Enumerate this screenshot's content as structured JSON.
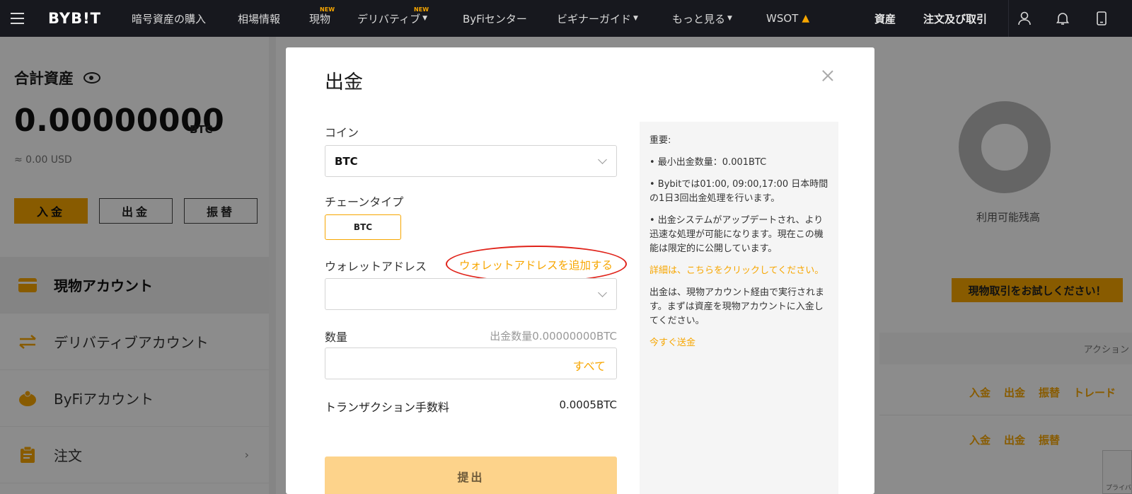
{
  "nav": {
    "logo": "BYB!T",
    "items": [
      {
        "label": "暗号資産の購入",
        "badge": ""
      },
      {
        "label": "相場情報",
        "badge": ""
      },
      {
        "label": "現物",
        "badge": "NEW"
      },
      {
        "label": "デリバティブ",
        "badge": "NEW"
      },
      {
        "label": "ByFiセンター",
        "badge": ""
      },
      {
        "label": "ビギナーガイド",
        "badge": ""
      },
      {
        "label": "もっと見る",
        "badge": ""
      },
      {
        "label": "WSOT",
        "badge": ""
      }
    ],
    "right": {
      "assets": "資産",
      "orders": "注文及び取引"
    }
  },
  "left": {
    "total_title": "合計資産",
    "total_value": "0.00000000",
    "total_unit": "BTC",
    "total_usd": "≈ 0.00 USD",
    "buttons": {
      "deposit": "入金",
      "withdraw": "出金",
      "transfer": "振替"
    },
    "accounts": [
      {
        "label": "現物アカウント"
      },
      {
        "label": "デリバティブアカウント"
      },
      {
        "label": "ByFiアカウント"
      },
      {
        "label": "注文"
      }
    ]
  },
  "right": {
    "available": "利用可能残高",
    "try_spot": "現物取引をお試しください！",
    "action_header": "アクション",
    "row1_actions": [
      "入金",
      "出金",
      "振替",
      "トレード"
    ],
    "row2_actions": [
      "入金",
      "出金",
      "振替"
    ],
    "captcha_text": "プライバ"
  },
  "modal": {
    "title": "出金",
    "coin_label": "コイン",
    "coin_value": "BTC",
    "chain_label": "チェーンタイプ",
    "chain_value": "BTC",
    "wallet_label": "ウォレットアドレス",
    "add_wallet": "ウォレットアドレスを追加する",
    "qty_label": "数量",
    "qty_max": "出金数量0.00000000BTC",
    "qty_all": "すべて",
    "fee_label": "トランザクション手数料",
    "fee_value": "0.0005BTC",
    "submit": "提出"
  },
  "notice": {
    "title": "重要:",
    "p1": "• 最小出金数量：0.001BTC",
    "p2": "• Bybitでは01:00, 09:00,17:00 日本時間の1日3回出金処理を行います。",
    "p3": "• 出金システムがアップデートされ、より迅速な処理が可能になります。現在この機能は限定的に公開しています。",
    "link1": "詳細は、こちらをクリックしてください。",
    "p4": "出金は、現物アカウント経由で実行されます。まずは資産を現物アカウントに入金してください。",
    "link2": "今すぐ送金"
  },
  "colors": {
    "accent": "#f7a600",
    "nav_bg": "#17181e",
    "highlight": "#e0231a"
  }
}
